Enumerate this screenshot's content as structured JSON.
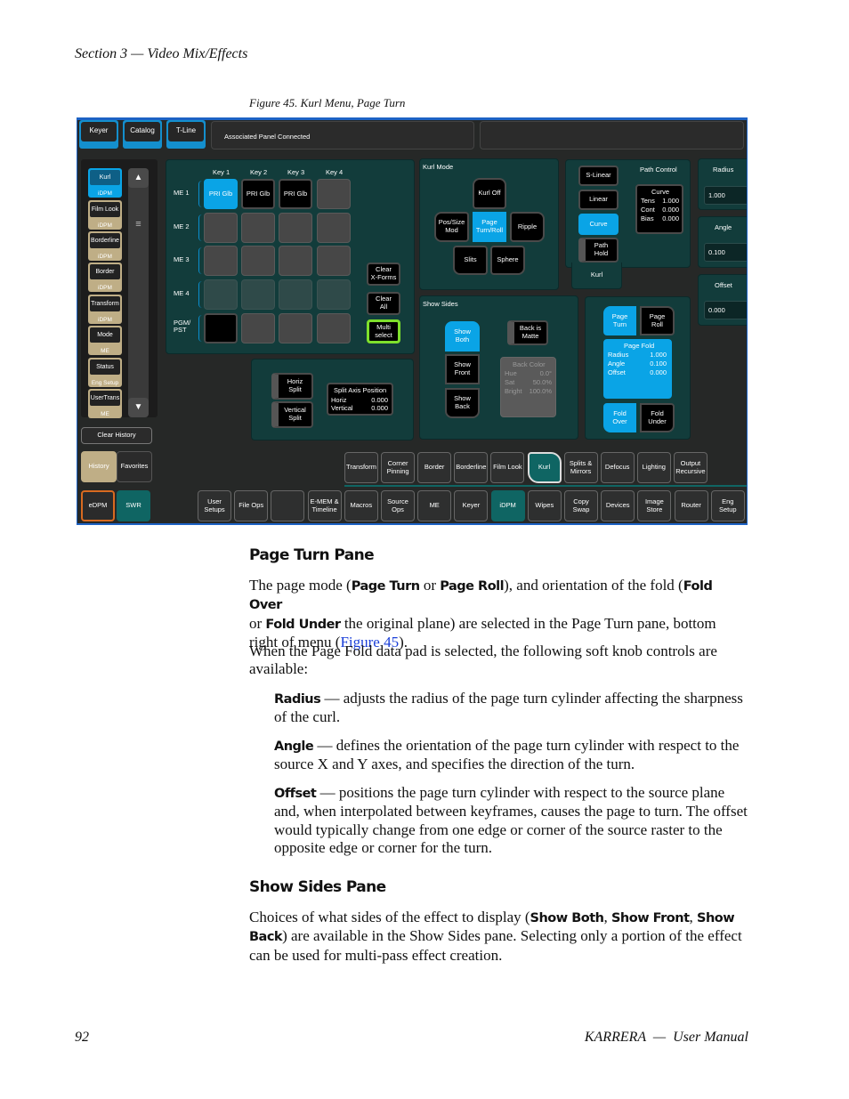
{
  "header": {
    "section": "Section 3 — Video Mix/Effects"
  },
  "figure": {
    "caption": "Figure 45.  Kurl Menu, Page Turn"
  },
  "ui": {
    "top_tabs": [
      "Keyer",
      "Catalog",
      "T-Line"
    ],
    "status": "Associated Panel Connected",
    "sidebar": [
      {
        "t": "Kurl",
        "s": "iDPM"
      },
      {
        "t": "Film Look",
        "s": "iDPM"
      },
      {
        "t": "Borderline",
        "s": "iDPM"
      },
      {
        "t": "Border",
        "s": "iDPM"
      },
      {
        "t": "Transform",
        "s": "iDPM"
      },
      {
        "t": "Mode",
        "s": "ME"
      },
      {
        "t": "Status",
        "s": "Eng  Setup"
      },
      {
        "t": "UserTrans",
        "s": "ME"
      }
    ],
    "clear_history": "Clear History",
    "history": "History",
    "favorites": "Favorites",
    "edpm": "eDPM",
    "swr": "SWR",
    "keys": [
      "Key 1",
      "Key 2",
      "Key 3",
      "Key 4"
    ],
    "me_rows": [
      "ME 1",
      "ME 2",
      "ME 3",
      "ME 4",
      "PGM/\nPST"
    ],
    "pri": "PRI Glb",
    "clear_xforms": "Clear\nX-Forms",
    "clear_all": "Clear\nAll",
    "multi_select": "Multi\nselect",
    "horiz_split": "Horiz\nSplit",
    "vertical_split": "Vertical\nSplit",
    "split_axis": {
      "title": "Split Axis Position",
      "horiz_l": "Horiz",
      "horiz_v": "0.000",
      "vert_l": "Vertical",
      "vert_v": "0.000"
    },
    "kurl_mode": {
      "title": "Kurl Mode",
      "off": "Kurl Off",
      "pos": "Pos/Size\nMod",
      "page": "Page\nTurn/Roll",
      "ripple": "Ripple",
      "slits": "Slits",
      "sphere": "Sphere"
    },
    "path": {
      "title": "Path Control",
      "slinear": "S-Linear",
      "linear": "Linear",
      "curve": "Curve",
      "hold": "Path\nHold",
      "tab": "Kurl",
      "box_title": "Curve",
      "tens_l": "Tens",
      "tens_v": "1.000",
      "cont_l": "Cont",
      "cont_v": "0.000",
      "bias_l": "Bias",
      "bias_v": "0.000"
    },
    "knobs": [
      {
        "label": "Radius",
        "value": "1.000"
      },
      {
        "label": "Angle",
        "value": "0.100"
      },
      {
        "label": "Offset",
        "value": "0.000"
      }
    ],
    "show_sides": {
      "title": "Show Sides",
      "both": "Show\nBoth",
      "front": "Show\nFront",
      "back": "Show\nBack",
      "matte": "Back is\nMatte",
      "color_title": "Back Color",
      "hue_l": "Hue",
      "hue_v": "0.0°",
      "sat_l": "Sat",
      "sat_v": "50.0%",
      "bright_l": "Bright",
      "bright_v": "100.0%"
    },
    "page": {
      "turn": "Page\nTurn",
      "roll": "Page\nRoll",
      "fold_title": "Page Fold",
      "radius_l": "Radius",
      "radius_v": "1.000",
      "angle_l": "Angle",
      "angle_v": "0.100",
      "offset_l": "Offset",
      "offset_v": "0.000",
      "over": "Fold\nOver",
      "under": "Fold\nUnder"
    },
    "sub_tabs": [
      "Transform",
      "Corner\nPinning",
      "Border",
      "Borderline",
      "Film Look",
      "Kurl",
      "Splits &\nMirrors",
      "Defocus",
      "Lighting",
      "Output\nRecursive"
    ],
    "main_tabs": [
      "User\nSetups",
      "File Ops",
      "",
      "E-MEM &\nTimeline",
      "Macros",
      "Source\nOps",
      "ME",
      "Keyer",
      "iDPM",
      "Wipes",
      "Copy\nSwap",
      "Devices",
      "Image\nStore",
      "Router",
      "Eng\nSetup"
    ],
    "colors": {
      "active": "#0aa4e6",
      "panel": "#123c3b",
      "selected_tab": "#0f6563",
      "sidebar_tan": "#bfae86",
      "multi_select": "#7ee02c"
    }
  },
  "s1": {
    "title": "Page Turn Pane",
    "p1": [
      "The page mode (",
      "Page Turn",
      " or ",
      "Page Roll",
      "), and orientation of the fold (",
      "Fold Over",
      "or ",
      "Fold Under",
      " the original plane) are selected in the Page Turn pane, bottom right of menu (",
      "Figure 45",
      ")."
    ],
    "p2": "When the Page Fold data pad is selected, the following soft knob controls are available:",
    "items": [
      {
        "k": "Radius",
        "t": " — adjusts the radius of the page turn cylinder affecting the sharpness of the curl."
      },
      {
        "k": "Angle",
        "t": " — defines the orientation of the page turn cylinder with respect to the source X and Y axes, and specifies the direction of the turn."
      },
      {
        "k": "Offset",
        "t": " — positions the page turn cylinder with respect to the source plane and, when interpolated between keyframes, causes the page to turn. The offset would typically change from one edge or corner of the source raster to the opposite edge or corner for the turn."
      }
    ]
  },
  "s2": {
    "title": "Show Sides Pane",
    "p1": [
      "Choices of what sides of the effect to display (",
      "Show Both",
      ", ",
      "Show Front",
      ", ",
      "Show Back",
      ") are available in the Show Sides pane. Selecting only a portion of the effect can be used for multi-pass effect creation."
    ]
  },
  "footer": {
    "page": "92",
    "title": "KARRERA  —  User Manual"
  }
}
